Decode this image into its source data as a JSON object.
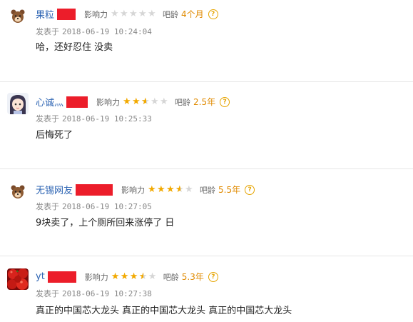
{
  "labels": {
    "influence": "影响力",
    "bar_age": "吧龄",
    "posted_at": "发表于",
    "help": "?"
  },
  "colors": {
    "username": "#2d64b3",
    "redaction": "#ec1d2a",
    "star_on": "#f2a900",
    "star_off": "#d6d6d6",
    "age": "#e08a00"
  },
  "posts": [
    {
      "username": "果粒",
      "avatar_icon": "bear-avatar-icon",
      "influence_stars": 0,
      "bar_age": "4个月",
      "time": "2018-06-19 10:24:04",
      "content": "哈，还好忍住 没卖"
    },
    {
      "username": "心诚灬",
      "avatar_icon": "girl-avatar-icon",
      "influence_stars": 2.5,
      "bar_age": "2.5年",
      "time": "2018-06-19 10:25:33",
      "content": "后悔死了"
    },
    {
      "username": "无锡网友",
      "avatar_icon": "bear-avatar-icon",
      "influence_stars": 3.5,
      "bar_age": "5.5年",
      "time": "2018-06-19 10:27:05",
      "content": "9块卖了，上个厕所回来涨停了 日"
    },
    {
      "username": "yt",
      "avatar_icon": "tomato-avatar-icon",
      "influence_stars": 3.5,
      "bar_age": "5.3年",
      "time": "2018-06-19 10:27:38",
      "content": "真正的中国芯大龙头 真正的中国芯大龙头 真正的中国芯大龙头"
    }
  ]
}
